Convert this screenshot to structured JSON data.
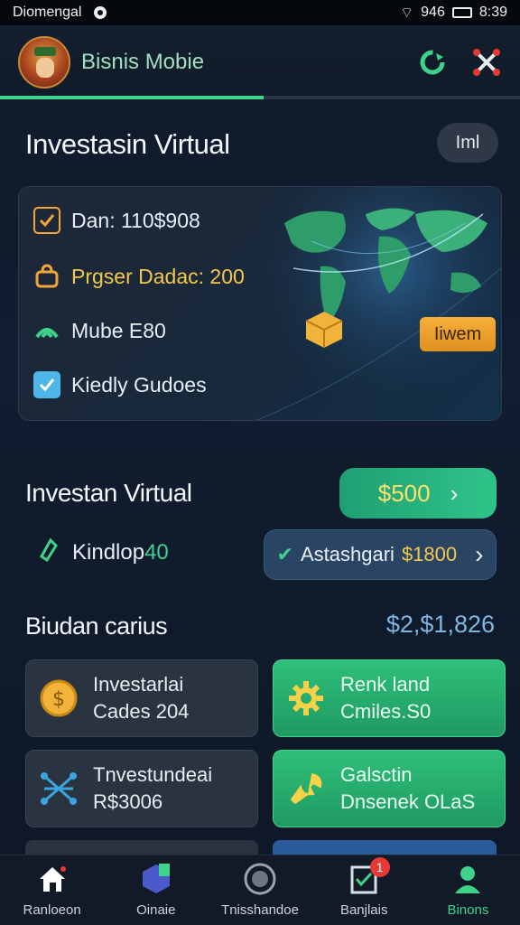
{
  "status_bar": {
    "carrier": "Diomengal",
    "signal_text": "946",
    "time": "8:39"
  },
  "header": {
    "app_name": "Bisnis Mobie",
    "icons": [
      "avatar",
      "refresh-icon",
      "settings-cross-icon"
    ]
  },
  "tab_progress": 0.5,
  "section1": {
    "title": "Investasin Virtual",
    "action_label": "Iml"
  },
  "card": {
    "rows": [
      {
        "icon": "checkbox-checked-icon",
        "text": "Dan: 110$908"
      },
      {
        "icon": "bag-icon",
        "text": "Prgser Dadac: 200"
      },
      {
        "icon": "signal-icon",
        "text": "Mube E80"
      },
      {
        "icon": "checkbox-checked-icon",
        "text": "Kiedly Gudoes"
      }
    ],
    "view_button": "Iiwem"
  },
  "section2": {
    "title": "Investan Virtual",
    "green_button_amount": "$500",
    "sub_label": "Kindlop",
    "sub_amount": "40",
    "blue_button_label": "Astashgari",
    "blue_button_amount": "$1800"
  },
  "section3": {
    "title": "Biudan carius",
    "total": "$2,$1,826"
  },
  "tiles": [
    {
      "icon": "coin-icon",
      "line1": "Investarlai",
      "line2": "Cades 204",
      "style": "dark"
    },
    {
      "icon": "gear-icon",
      "line1": "Renk land",
      "line2": "Cmiles.S0",
      "style": "green"
    },
    {
      "icon": "network-icon",
      "line1": "Tnvestundeai",
      "line2": "R$3006",
      "style": "dark"
    },
    {
      "icon": "wrench-icon",
      "line1": "Galsctin",
      "line2": "Dnsenek OLaS",
      "style": "green"
    }
  ],
  "bottom_nav": [
    {
      "icon": "home-icon",
      "label": "Ranloeon"
    },
    {
      "icon": "cube-icon",
      "label": "Oinaie"
    },
    {
      "icon": "target-icon",
      "label": "Tnisshandoe"
    },
    {
      "icon": "checklist-icon",
      "label": "Banjlais",
      "badge": "1"
    },
    {
      "icon": "user-icon",
      "label": "Binons"
    }
  ],
  "colors": {
    "accent_green": "#3fd28a",
    "accent_gold": "#f5c84c",
    "background": "#0f1a2b"
  }
}
